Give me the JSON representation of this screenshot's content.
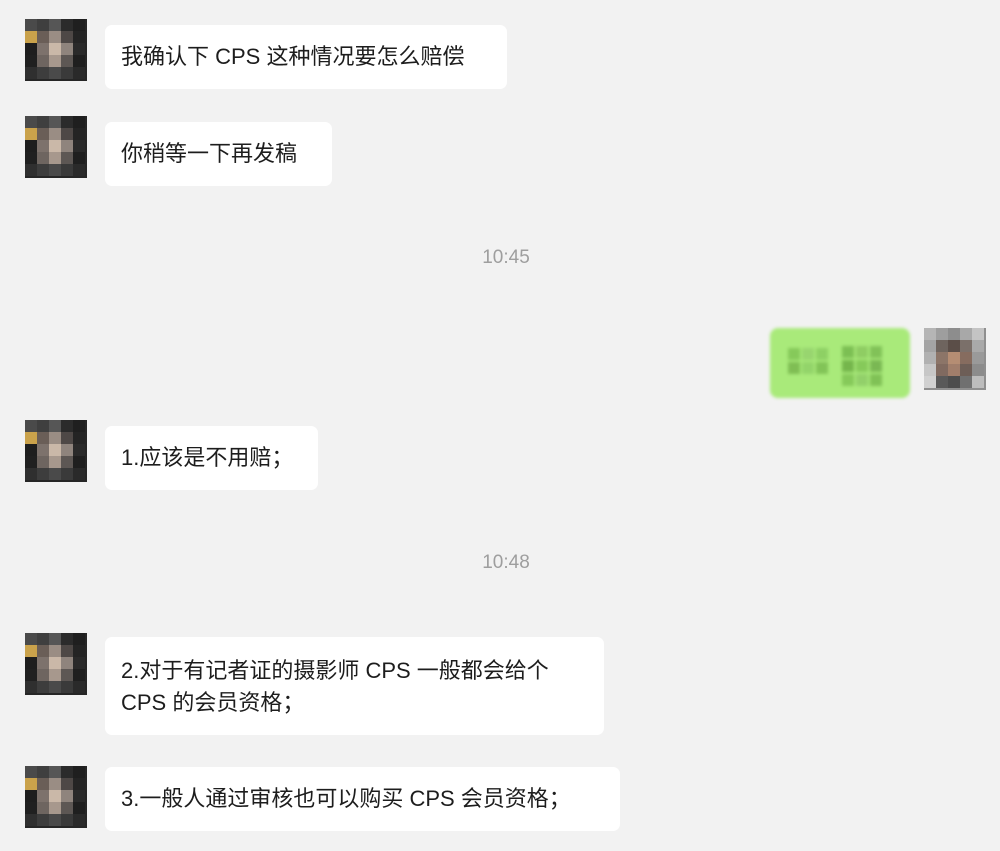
{
  "messages": [
    {
      "side": "left",
      "text": "我确认下 CPS 这种情况要怎么赔偿",
      "avatar_icon": "pixelated-contact-avatar"
    },
    {
      "side": "left",
      "text": "你稍等一下再发稿",
      "avatar_icon": "pixelated-contact-avatar"
    },
    {
      "side": "right",
      "text": "",
      "avatar_icon": "pixelated-self-avatar"
    },
    {
      "side": "left",
      "text": "1.应该是不用赔；",
      "avatar_icon": "pixelated-contact-avatar"
    },
    {
      "side": "left",
      "lines": [
        "2.对于有记者证的摄影师 CPS 一般都会给个",
        "CPS 的会员资格；"
      ],
      "avatar_icon": "pixelated-contact-avatar"
    },
    {
      "side": "left",
      "text": "3.一般人通过审核也可以购买 CPS 会员资格；",
      "avatar_icon": "pixelated-contact-avatar"
    }
  ],
  "timestamps": [
    "10:45",
    "10:48"
  ],
  "colors": {
    "background": "#f2f2f2",
    "incoming_bubble": "#ffffff",
    "outgoing_bubble": "#a9ea7a",
    "timestamp_text": "#9e9e9e",
    "message_text": "#1d1d1d"
  }
}
